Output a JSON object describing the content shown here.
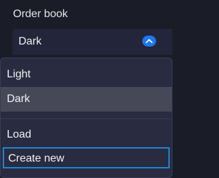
{
  "section": {
    "title": "Order book"
  },
  "select": {
    "value": "Dark",
    "toggle_icon": "chevron-up-icon",
    "accent_color": "#1d78f2"
  },
  "menu": {
    "items": [
      {
        "label": "Light",
        "selected": false
      },
      {
        "label": "Dark",
        "selected": true
      },
      {
        "label": "Load",
        "selected": false
      },
      {
        "label": "Create new",
        "focused": true
      }
    ],
    "focus_color": "#1f86d8"
  }
}
